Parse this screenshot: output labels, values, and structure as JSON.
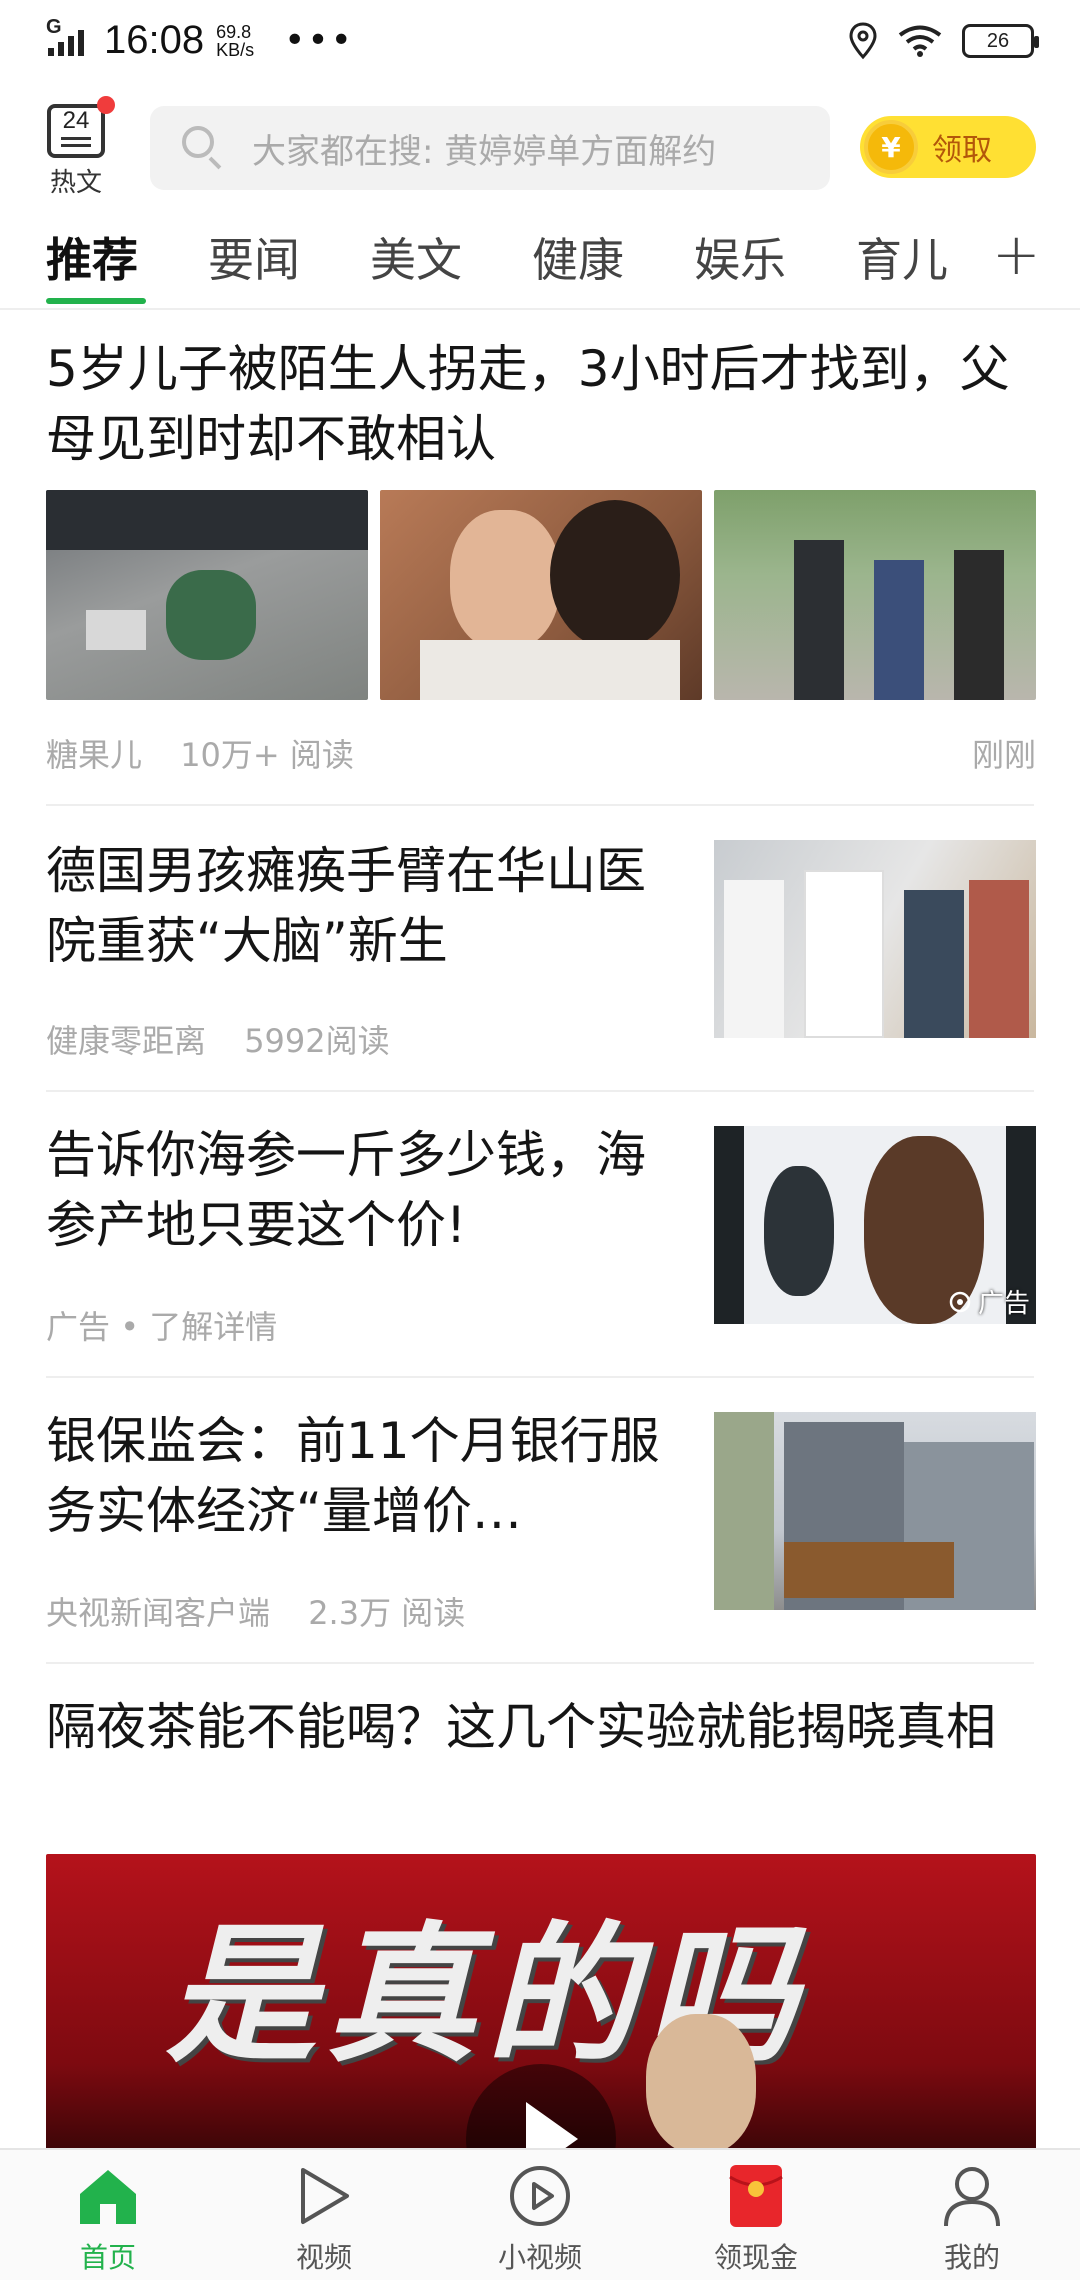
{
  "status_bar": {
    "signal": "G",
    "time": "16:08",
    "speed_value": "69.8",
    "speed_unit": "KB/s",
    "more": "•••",
    "battery": "26"
  },
  "header": {
    "hot_number": "24",
    "hot_label": "热文",
    "search_placeholder": "大家都在搜: 黄婷婷单方面解约",
    "claim_label": "领取",
    "coin_symbol": "¥"
  },
  "tabs": [
    {
      "label": "推荐",
      "active": true
    },
    {
      "label": "要闻"
    },
    {
      "label": "美文"
    },
    {
      "label": "健康"
    },
    {
      "label": "娱乐"
    },
    {
      "label": "育儿"
    }
  ],
  "tab_add": "+",
  "articles": [
    {
      "title": "5岁儿子被陌生人拐走，3小时后才找到，父母见到时却不敢相认",
      "source": "糖果儿",
      "reads": "10万+ 阅读",
      "time": "刚刚"
    },
    {
      "title": "德国男孩瘫痪手臂在华山医院重获“大脑”新生",
      "source": "健康零距离",
      "reads": "5992阅读"
    },
    {
      "title": "告诉你海参一斤多少钱，海参产地只要这个价!",
      "source": "广告",
      "reads": "了解详情",
      "ad_badge": "广告"
    },
    {
      "title": "银保监会：前11个月银行服务实体经济“量增价…",
      "source": "央视新闻客户端",
      "reads": "2.3万 阅读"
    },
    {
      "title": "隔夜茶能不能喝？这几个实验就能揭晓真相",
      "video_caption": "是真的吗"
    }
  ],
  "bottom_nav": [
    {
      "label": "首页",
      "icon": "home-icon",
      "active": true
    },
    {
      "label": "视频",
      "icon": "play-icon"
    },
    {
      "label": "小视频",
      "icon": "small-video-icon"
    },
    {
      "label": "领现金",
      "icon": "red-envelope-icon"
    },
    {
      "label": "我的",
      "icon": "profile-icon"
    }
  ],
  "colors": {
    "accent": "#22b24c",
    "coin_bg": "#ffe033",
    "notification": "#f03c3c"
  }
}
